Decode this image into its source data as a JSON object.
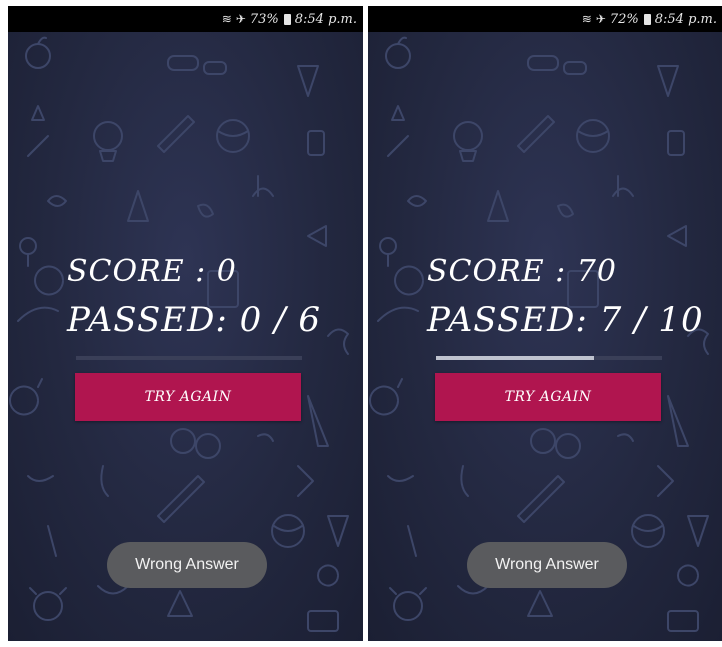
{
  "colors": {
    "background": "#232840",
    "doodle": "#3d4668",
    "button": "#b0154f",
    "toast": "#5a5b5e",
    "status_bar": "#000000"
  },
  "screens": [
    {
      "status": {
        "wifi_icon": "wifi-icon",
        "airplane_icon": "airplane-icon",
        "battery_percent": "73%",
        "battery_icon": "battery-icon",
        "time": "8:54 p.m."
      },
      "score_text": "SCORE : 0",
      "passed_text": "PASSED: 0 / 6",
      "progress_fraction": 0.0,
      "try_again_label": "TRY AGAIN",
      "toast_text": "Wrong Answer"
    },
    {
      "status": {
        "wifi_icon": "wifi-icon",
        "airplane_icon": "airplane-icon",
        "battery_percent": "72%",
        "battery_icon": "battery-icon",
        "time": "8:54 p.m."
      },
      "score_text": "SCORE : 70",
      "passed_text": "PASSED: 7 / 10",
      "progress_fraction": 0.7,
      "try_again_label": "TRY AGAIN",
      "toast_text": "Wrong Answer"
    }
  ]
}
